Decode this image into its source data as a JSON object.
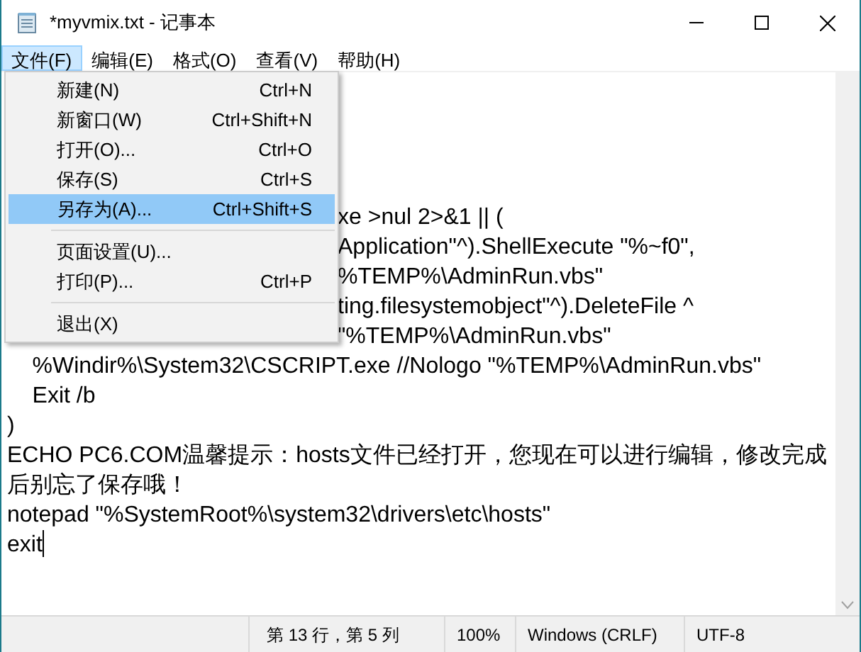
{
  "window": {
    "title": "*myvmix.txt - 记事本"
  },
  "menu_bar": [
    {
      "label": "文件(F)",
      "selected": true
    },
    {
      "label": "编辑(E)",
      "selected": false
    },
    {
      "label": "格式(O)",
      "selected": false
    },
    {
      "label": "查看(V)",
      "selected": false
    },
    {
      "label": "帮助(H)",
      "selected": false
    }
  ],
  "file_menu": [
    {
      "kind": "item",
      "label": "新建(N)",
      "shortcut": "Ctrl+N",
      "selected": false
    },
    {
      "kind": "item",
      "label": "新窗口(W)",
      "shortcut": "Ctrl+Shift+N",
      "selected": false
    },
    {
      "kind": "item",
      "label": "打开(O)...",
      "shortcut": "Ctrl+O",
      "selected": false
    },
    {
      "kind": "item",
      "label": "保存(S)",
      "shortcut": "Ctrl+S",
      "selected": false
    },
    {
      "kind": "item",
      "label": "另存为(A)...",
      "shortcut": "Ctrl+Shift+S",
      "selected": true
    },
    {
      "kind": "separator"
    },
    {
      "kind": "item",
      "label": "页面设置(U)...",
      "selected": false
    },
    {
      "kind": "item",
      "label": "打印(P)...",
      "shortcut": "Ctrl+P",
      "selected": false
    },
    {
      "kind": "separator"
    },
    {
      "kind": "item",
      "label": "退出(X)",
      "selected": false
    }
  ],
  "editor": {
    "covered_line_tails": [
      "xe >nul 2>&1 || (",
      "Application\"^).ShellExecute \"%~f0\",",
      "%TEMP%\\AdminRun.vbs\"",
      "ting.filesystemobject\"^).DeleteFile ^",
      "\"%TEMP%\\AdminRun.vbs\""
    ],
    "lines": [
      {
        "text": "    %Windir%\\System32\\CSCRIPT.exe //Nologo \"%TEMP%\\AdminRun.vbs\"",
        "caret": false
      },
      {
        "text": "    Exit /b",
        "caret": false
      },
      {
        "text": ")",
        "caret": false
      },
      {
        "text": "ECHO PC6.COM温馨提示：hosts文件已经打开，您现在可以进行编辑，修改完成后别忘了保存哦！",
        "caret": false
      },
      {
        "text": "notepad \"%SystemRoot%\\system32\\drivers\\etc\\hosts\"",
        "caret": false
      },
      {
        "text": "exit",
        "caret": true
      }
    ]
  },
  "status_bar": {
    "position": "第 13 行，第 5 列",
    "zoom": "100%",
    "line_ending": "Windows (CRLF)",
    "encoding": "UTF-8"
  }
}
